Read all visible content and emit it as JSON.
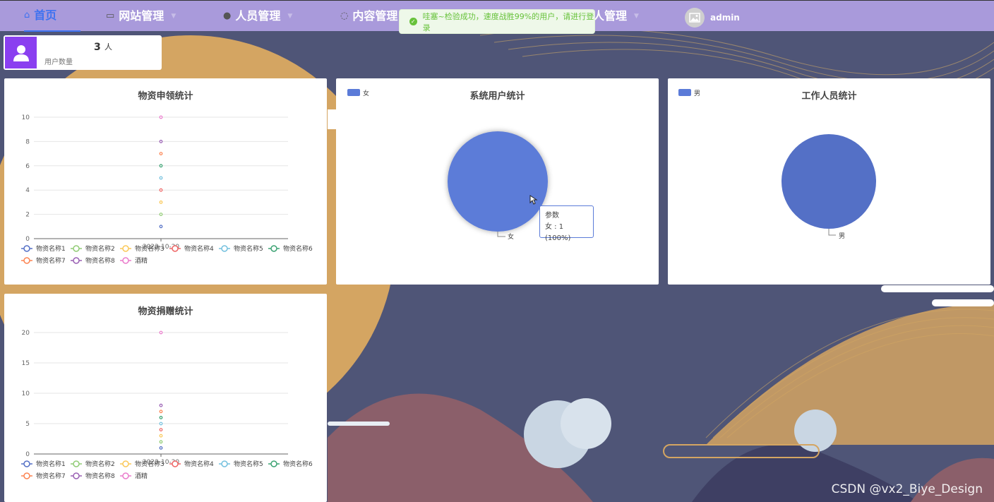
{
  "nav": {
    "items": [
      {
        "label": "首页",
        "icon": "home-icon"
      },
      {
        "label": "网站管理",
        "icon": "monitor-icon"
      },
      {
        "label": "人员管理",
        "icon": "person-icon"
      },
      {
        "label": "内容管理",
        "icon": "chat-icon"
      },
      {
        "label": "人管理",
        "icon": ""
      }
    ],
    "user": "admin"
  },
  "toast": {
    "text": "哇塞~检验成功，速度战胜99%的用户，请进行登录"
  },
  "stat": {
    "value": "3",
    "unit": "人",
    "label": "用户数量"
  },
  "panels": {
    "apply_title": "物资申领统计",
    "users_title": "系统用户统计",
    "staff_title": "工作人员统计",
    "donate_title": "物资捐赠统计",
    "users_legend": "女",
    "staff_legend": "男",
    "users_slice_label": "女",
    "staff_slice_label": "男",
    "tooltip_title": "参数",
    "tooltip_value": "女 : 1 (100%)",
    "x_date": "2023-10-20"
  },
  "legend_items": [
    "物资名称1",
    "物资名称2",
    "物资名称3",
    "物资名称4",
    "物资名称5",
    "物资名称6",
    "物资名称7",
    "物资名称8",
    "酒精"
  ],
  "colors": [
    "#5470c6",
    "#91cc75",
    "#fac858",
    "#ee6666",
    "#73c0de",
    "#3ba272",
    "#fc8452",
    "#9a60b4",
    "#ea7ccc"
  ],
  "chart_data": [
    {
      "type": "scatter",
      "title": "物资申领统计",
      "categories": [
        "2023-10-20"
      ],
      "ylim": [
        0,
        10
      ],
      "yticks": [
        0,
        2,
        4,
        6,
        8,
        10
      ],
      "series": [
        {
          "name": "物资名称1",
          "values": [
            1
          ]
        },
        {
          "name": "物资名称2",
          "values": [
            2
          ]
        },
        {
          "name": "物资名称3",
          "values": [
            3
          ]
        },
        {
          "name": "物资名称4",
          "values": [
            4
          ]
        },
        {
          "name": "物资名称5",
          "values": [
            5
          ]
        },
        {
          "name": "物资名称6",
          "values": [
            6
          ]
        },
        {
          "name": "物资名称7",
          "values": [
            7
          ]
        },
        {
          "name": "物资名称8",
          "values": [
            8
          ]
        },
        {
          "name": "酒精",
          "values": [
            10
          ]
        }
      ]
    },
    {
      "type": "pie",
      "title": "系统用户统计",
      "series_name": "参数",
      "slices": [
        {
          "name": "女",
          "value": 1
        }
      ]
    },
    {
      "type": "pie",
      "title": "工作人员统计",
      "slices": [
        {
          "name": "男",
          "value": 1
        }
      ]
    },
    {
      "type": "scatter",
      "title": "物资捐赠统计",
      "categories": [
        "2023-10-20"
      ],
      "ylim": [
        0,
        20
      ],
      "yticks": [
        0,
        5,
        10,
        15,
        20
      ],
      "series": [
        {
          "name": "物资名称1",
          "values": [
            1
          ]
        },
        {
          "name": "物资名称2",
          "values": [
            2
          ]
        },
        {
          "name": "物资名称3",
          "values": [
            3
          ]
        },
        {
          "name": "物资名称4",
          "values": [
            4
          ]
        },
        {
          "name": "物资名称5",
          "values": [
            5
          ]
        },
        {
          "name": "物资名称6",
          "values": [
            6
          ]
        },
        {
          "name": "物资名称7",
          "values": [
            7
          ]
        },
        {
          "name": "物资名称8",
          "values": [
            8
          ]
        },
        {
          "name": "酒精",
          "values": [
            20
          ]
        }
      ]
    }
  ],
  "watermark": "CSDN @vx2_Biye_Design"
}
